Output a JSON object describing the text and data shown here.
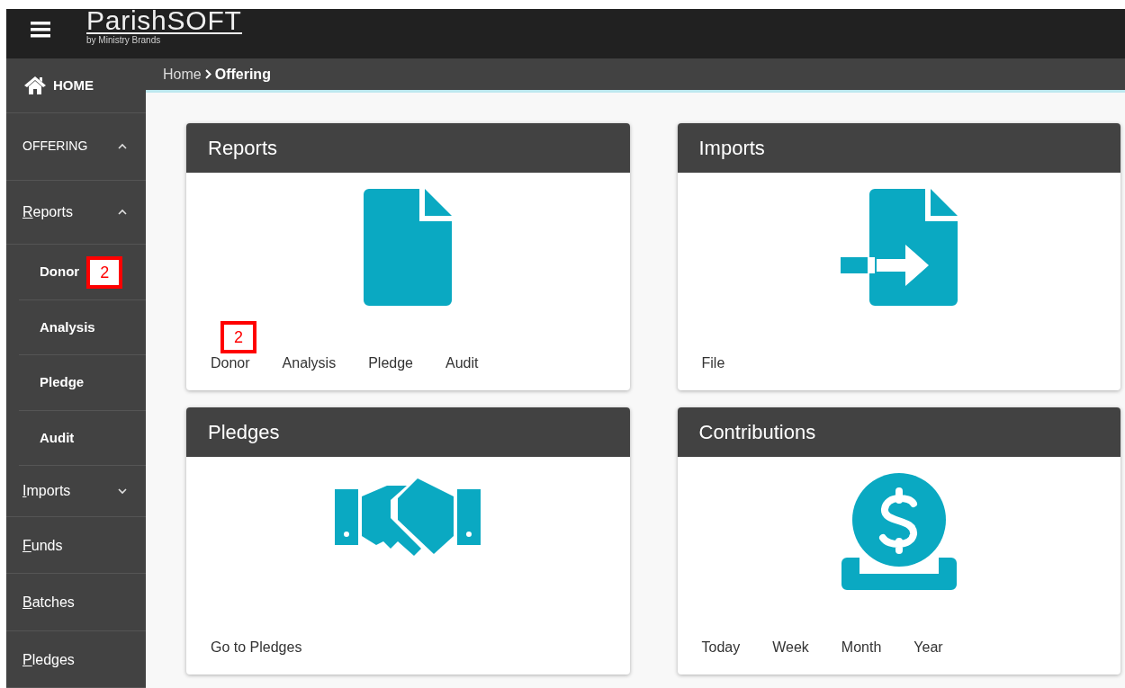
{
  "header": {
    "logo_text": "ParishSOFT",
    "logo_tagline": "by Ministry Brands"
  },
  "breadcrumb": [
    {
      "label": "Home",
      "current": false
    },
    {
      "label": "Offering",
      "current": true
    }
  ],
  "sidebar": {
    "items": [
      {
        "kind": "home",
        "label": "HOME"
      },
      {
        "kind": "section",
        "label": "OFFERING",
        "expanded": true
      },
      {
        "kind": "group",
        "label": "Reports",
        "expanded": true,
        "access_key": true
      },
      {
        "kind": "sub",
        "label": "Donor",
        "callout": "2"
      },
      {
        "kind": "sub",
        "label": "Analysis"
      },
      {
        "kind": "sub",
        "label": "Pledge"
      },
      {
        "kind": "sub",
        "label": "Audit"
      },
      {
        "kind": "group",
        "label": "Imports",
        "expanded": false,
        "access_key": true
      },
      {
        "kind": "link",
        "label": "Funds",
        "access_key": true
      },
      {
        "kind": "link",
        "label": "Batches",
        "access_key": true
      },
      {
        "kind": "link",
        "label": "Pledges",
        "access_key": true
      }
    ]
  },
  "cards": [
    {
      "title": "Reports",
      "kind": "document",
      "links": [
        {
          "label": "Donor",
          "callout": "2"
        },
        {
          "label": "Analysis"
        },
        {
          "label": "Pledge"
        },
        {
          "label": "Audit"
        }
      ]
    },
    {
      "title": "Imports",
      "kind": "import",
      "links": [
        {
          "label": "File"
        }
      ]
    },
    {
      "title": "Pledges",
      "kind": "handshake",
      "links": [
        {
          "label": "Go to Pledges"
        }
      ]
    },
    {
      "title": "Contributions",
      "kind": "coin",
      "links": [
        {
          "label": "Today"
        },
        {
          "label": "Week"
        },
        {
          "label": "Month"
        },
        {
          "label": "Year"
        }
      ]
    }
  ]
}
